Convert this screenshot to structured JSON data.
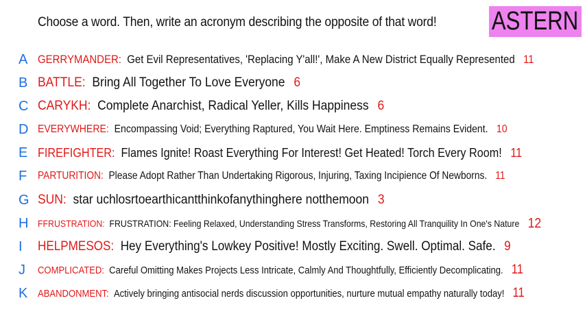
{
  "prompt": "Choose a word. Then, write an acronym describing the opposite of that word!",
  "badge": "ASTERN",
  "entries": [
    {
      "letter": "A",
      "word": "GERRYMANDER:",
      "acronym": "Get Evil Representatives, 'Replacing Y'all!', Make A New District Equally Represented",
      "score": "11"
    },
    {
      "letter": "B",
      "word": "BATTLE:",
      "acronym": "Bring All Together To Love Everyone",
      "score": "6"
    },
    {
      "letter": "C",
      "word": "CARYKH:",
      "acronym": "Complete Anarchist, Radical Yeller, Kills Happiness",
      "score": "6"
    },
    {
      "letter": "D",
      "word": "EVERYWHERE:",
      "acronym": "Encompassing Void; Everything Raptured, You Wait Here. Emptiness Remains Evident.",
      "score": "10"
    },
    {
      "letter": "E",
      "word": "FIREFIGHTER:",
      "acronym": "Flames Ignite! Roast Everything For Interest! Get Heated! Torch Every Room!",
      "score": "11"
    },
    {
      "letter": "F",
      "word": "PARTURITION:",
      "acronym": "Please Adopt Rather Than Undertaking Rigorous, Injuring, Taxing Incipience Of Newborns.",
      "score": "11"
    },
    {
      "letter": "G",
      "word": "SUN:",
      "acronym": "star uchlosrtoearthicantthinkofanythinghere notthemoon",
      "score": "3"
    },
    {
      "letter": "H",
      "word": "FFRUSTRATION:",
      "acronym": "FRUSTRATION: Feeling Relaxed, Understanding Stress Transforms, Restoring All Tranquility In One's Nature",
      "score": "12"
    },
    {
      "letter": "I",
      "word": "HELPMESOS:",
      "acronym": "Hey Everything's Lowkey Positive! Mostly Exciting. Swell. Optimal. Safe.",
      "score": "9"
    },
    {
      "letter": "J",
      "word": "COMPLICATED:",
      "acronym": "Careful Omitting Makes Projects Less Intricate, Calmly And Thoughtfully, Efficiently Decomplicating.",
      "score": "11"
    },
    {
      "letter": "K",
      "word": "ABANDONMENT:",
      "acronym": "Actively bringing antisocial nerds discussion opportunities, nurture mutual empathy naturally today!",
      "score": "11"
    }
  ]
}
